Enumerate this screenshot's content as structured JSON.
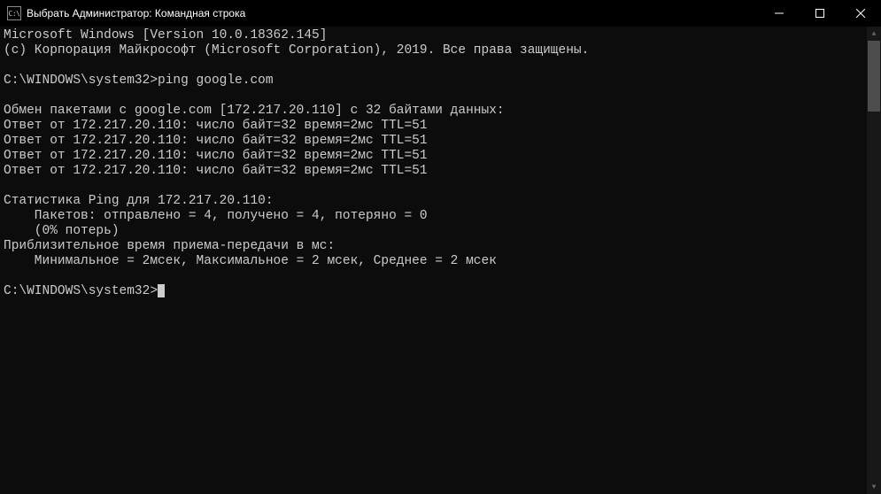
{
  "titlebar": {
    "icon_text": "C:\\",
    "title": "Выбрать Администратор: Командная строка"
  },
  "terminal": {
    "lines": [
      "Microsoft Windows [Version 10.0.18362.145]",
      "(c) Корпорация Майкрософт (Microsoft Corporation), 2019. Все права защищены.",
      "",
      "C:\\WINDOWS\\system32>ping google.com",
      "",
      "Обмен пакетами с google.com [172.217.20.110] с 32 байтами данных:",
      "Ответ от 172.217.20.110: число байт=32 время=2мс TTL=51",
      "Ответ от 172.217.20.110: число байт=32 время=2мс TTL=51",
      "Ответ от 172.217.20.110: число байт=32 время=2мс TTL=51",
      "Ответ от 172.217.20.110: число байт=32 время=2мс TTL=51",
      "",
      "Статистика Ping для 172.217.20.110:",
      "    Пакетов: отправлено = 4, получено = 4, потеряно = 0",
      "    (0% потерь)",
      "Приблизительное время приема-передачи в мс:",
      "    Минимальное = 2мсек, Максимальное = 2 мсек, Среднее = 2 мсек",
      ""
    ],
    "prompt": "C:\\WINDOWS\\system32>"
  }
}
